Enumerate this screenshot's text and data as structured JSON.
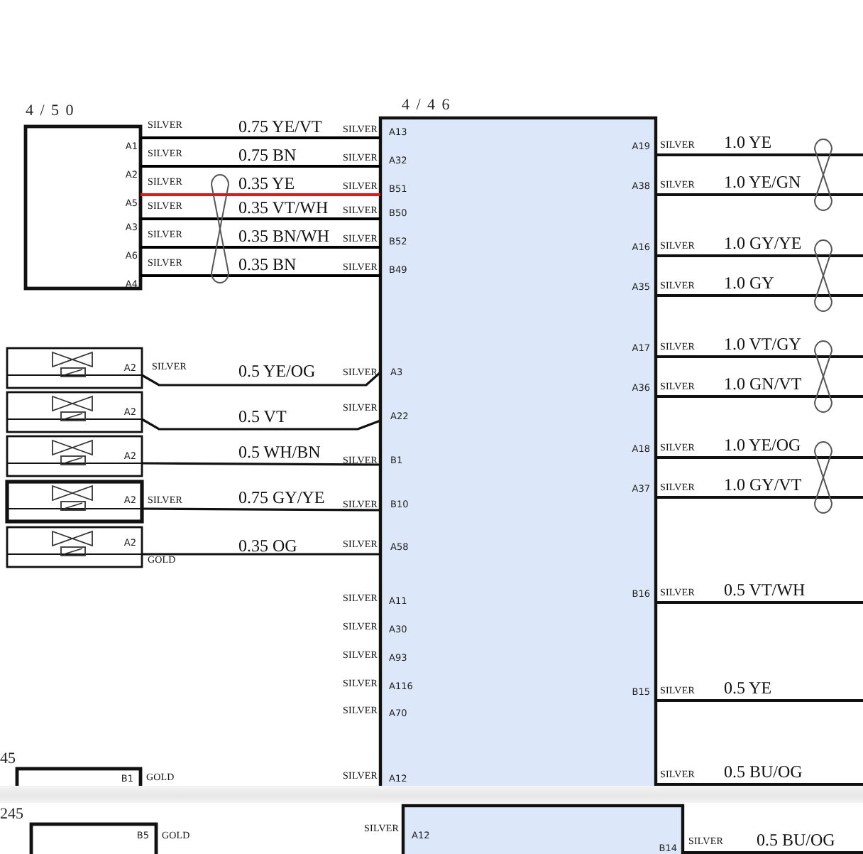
{
  "top_page": {
    "connector_title": "4 / 5 0",
    "module_title": "4 / 4 6",
    "harness_wires": [
      {
        "pin": "A1",
        "left_terminal": "SILVER",
        "wire": "0.75 YE/VT",
        "module_terminal": "SILVER",
        "module_pin": "A13",
        "color": "#000000"
      },
      {
        "pin": "A2",
        "left_terminal": "SILVER",
        "wire": "0.75 BN",
        "module_terminal": "SILVER",
        "module_pin": "A32",
        "color": "#000000"
      },
      {
        "pin": "A5",
        "left_terminal": "SILVER",
        "wire": "0.35 YE",
        "module_terminal": "SILVER",
        "module_pin": "B51",
        "color": "#e01818"
      },
      {
        "pin": "A3",
        "left_terminal": "SILVER",
        "wire": "0.35 VT/WH",
        "module_terminal": "SILVER",
        "module_pin": "B50",
        "color": "#000000"
      },
      {
        "pin": "A6",
        "left_terminal": "SILVER",
        "wire": "0.35 BN/WH",
        "module_terminal": "SILVER",
        "module_pin": "B52",
        "color": "#000000"
      },
      {
        "pin": "A4",
        "left_terminal": "SILVER",
        "wire": "0.35 BN",
        "module_terminal": "SILVER",
        "module_pin": "B49",
        "color": "#000000"
      }
    ],
    "devices": [
      {
        "pin": "A2",
        "left_terminal": "SILVER",
        "wire": "0.5 YE/OG",
        "module_terminal": "SILVER",
        "module_pin": "A3",
        "highlighted": false
      },
      {
        "pin": "A2",
        "wire": "0.5 VT",
        "module_terminal": "SILVER",
        "module_pin": "A22",
        "highlighted": false
      },
      {
        "pin": "A2",
        "wire": "0.5 WH/BN",
        "module_terminal": "SILVER",
        "module_pin": "B1",
        "highlighted": false
      },
      {
        "pin": "A2",
        "left_terminal": "SILVER",
        "wire": "0.75 GY/YE",
        "module_terminal": "SILVER",
        "module_pin": "B10",
        "highlighted": true
      },
      {
        "pin": "A2",
        "left_terminal": "GOLD",
        "wire": "0.35 OG",
        "module_terminal": "SILVER",
        "module_pin": "A58",
        "highlighted": false
      }
    ],
    "unwired_pins": [
      {
        "terminal": "SILVER",
        "pin": "A11"
      },
      {
        "terminal": "SILVER",
        "pin": "A30"
      },
      {
        "terminal": "SILVER",
        "pin": "A93"
      },
      {
        "terminal": "SILVER",
        "pin": "A116"
      },
      {
        "terminal": "SILVER",
        "pin": "A70"
      },
      {
        "terminal": "SILVER",
        "pin": "A12"
      }
    ],
    "right_wires": [
      {
        "pin": "A19",
        "terminal": "SILVER",
        "wire": "1.0 YE"
      },
      {
        "pin": "A38",
        "terminal": "SILVER",
        "wire": "1.0 YE/GN"
      },
      {
        "pin": "A16",
        "terminal": "SILVER",
        "wire": "1.0 GY/YE"
      },
      {
        "pin": "A35",
        "terminal": "SILVER",
        "wire": "1.0 GY"
      },
      {
        "pin": "A17",
        "terminal": "SILVER",
        "wire": "1.0 VT/GY"
      },
      {
        "pin": "A36",
        "terminal": "SILVER",
        "wire": "1.0 GN/VT"
      },
      {
        "pin": "A18",
        "terminal": "SILVER",
        "wire": "1.0 YE/OG"
      },
      {
        "pin": "A37",
        "terminal": "SILVER",
        "wire": "1.0 GY/VT"
      },
      {
        "pin": "B16",
        "terminal": "SILVER",
        "wire": "0.5 VT/WH"
      },
      {
        "pin": "B15",
        "terminal": "SILVER",
        "wire": "0.5 YE"
      },
      {
        "terminal": "SILVER",
        "wire": "0.5 BU/OG"
      }
    ],
    "lower_connector": {
      "title": "45",
      "pin": "B1",
      "terminal": "GOLD"
    }
  },
  "bottom_page": {
    "connector_title": "245",
    "pin": "B5",
    "terminal": "GOLD",
    "module_terminal": "SILVER",
    "module_pin": "A12",
    "right_pin": "B14",
    "right_terminal": "SILVER",
    "right_wire": "0.5 BU/OG"
  }
}
